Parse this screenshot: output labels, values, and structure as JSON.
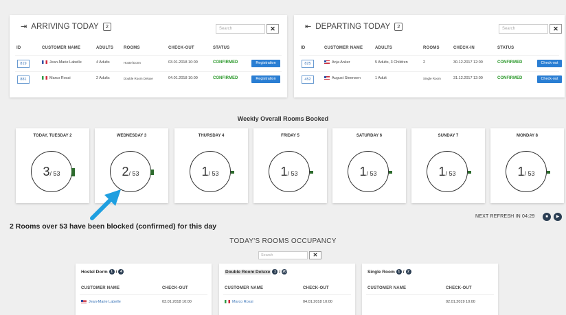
{
  "arriving": {
    "title": "ARRIVING TODAY",
    "count": "2",
    "search_placeholder": "Search",
    "clear": "✕",
    "columns": [
      "ID",
      "CUSTOMER NAME",
      "ADULTS",
      "ROOMS",
      "CHECK-OUT",
      "STATUS"
    ],
    "rows": [
      {
        "id": "819",
        "flag": "fr",
        "name": "Jean-Marie Labelle",
        "adults": "4 Adults",
        "room": "Hostel Dorm",
        "date": "03.01.2018 10:00",
        "status": "CONFIRMED",
        "action": "Registration"
      },
      {
        "id": "881",
        "flag": "it",
        "name": "Marco Rossi",
        "adults": "2 Adults",
        "room": "Double Room Deluxe",
        "date": "04.01.2018 10:00",
        "status": "CONFIRMED",
        "action": "Registration"
      }
    ]
  },
  "departing": {
    "title": "DEPARTING TODAY",
    "count": "2",
    "search_placeholder": "Search",
    "clear": "✕",
    "columns": [
      "ID",
      "CUSTOMER NAME",
      "ADULTS",
      "ROOMS",
      "CHECK-IN",
      "STATUS"
    ],
    "rows": [
      {
        "id": "825",
        "flag": "us",
        "name": "Anja Anker",
        "adults": "5 Adults, 3 Children",
        "room": "2",
        "date": "30.12.2017 12:00",
        "status": "CONFIRMED",
        "action": "Check-out"
      },
      {
        "id": "452",
        "flag": "us",
        "name": "August Steensen",
        "adults": "1 Adult",
        "room": "Single Room",
        "date": "31.12.2017 12:00",
        "status": "CONFIRMED",
        "action": "Check-out"
      }
    ]
  },
  "weekly": {
    "title": "Weekly Overall Rooms Booked",
    "days": [
      {
        "label": "TODAY, TUESDAY 2",
        "booked": "3",
        "total": "/ 53",
        "fraction": 0.0566
      },
      {
        "label": "WEDNESDAY 3",
        "booked": "2",
        "total": "/ 53",
        "fraction": 0.0377
      },
      {
        "label": "THURSDAY 4",
        "booked": "1",
        "total": "/ 53",
        "fraction": 0.0189
      },
      {
        "label": "FRIDAY 5",
        "booked": "1",
        "total": "/ 53",
        "fraction": 0.0189
      },
      {
        "label": "SATURDAY 6",
        "booked": "1",
        "total": "/ 53",
        "fraction": 0.0189
      },
      {
        "label": "SUNDAY 7",
        "booked": "1",
        "total": "/ 53",
        "fraction": 0.0189
      },
      {
        "label": "MONDAY 8",
        "booked": "1",
        "total": "/ 53",
        "fraction": 0.0189
      }
    ]
  },
  "annotation": "2 Rooms over 53 have been blocked (confirmed) for this day",
  "refresh": {
    "label": "NEXT REFRESH IN",
    "time": "04:29"
  },
  "occupancy": {
    "title": "TODAY'S ROOMS OCCUPANCY",
    "search_placeholder": "Search",
    "clear": "✕",
    "rooms": [
      {
        "name": "Hostel Dorm",
        "occupied": "1",
        "sep": "/",
        "capacity": "4",
        "columns": [
          "CUSTOMER NAME",
          "CHECK-OUT"
        ],
        "guest": "Jean-Marie Labelle",
        "flag": "us",
        "date": "03.01.2018 10:00"
      },
      {
        "name": "Double Room Deluxe",
        "occupied": "1",
        "sep": "/",
        "capacity": "20",
        "columns": [
          "CUSTOMER NAME",
          "CHECK-OUT"
        ],
        "guest": "Marco Rossi",
        "flag": "it",
        "date": "04.01.2018 10:00"
      },
      {
        "name": "Single Room",
        "occupied": "1",
        "sep": "/",
        "capacity": "2",
        "columns": [
          "CUSTOMER NAME",
          "CHECK-OUT"
        ],
        "guest": "",
        "flag": "",
        "date": "02.01.2019 10:00"
      }
    ]
  },
  "colors": {
    "accent": "#2a7ed3",
    "confirmed": "#2e9a2e",
    "tick": "#2d6b2d",
    "arrow": "#1f9fe0",
    "dark_badge": "#2a3d52"
  }
}
